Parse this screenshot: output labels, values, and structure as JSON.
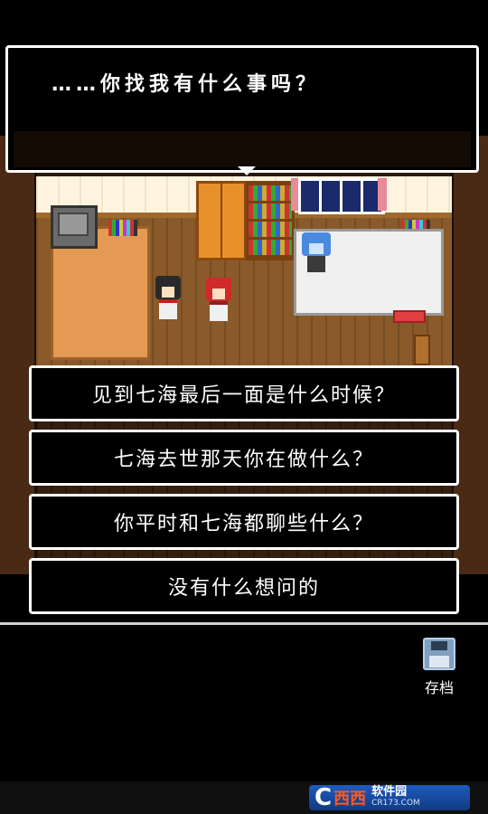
{
  "dialogue": {
    "text": "……你找我有什么事吗？"
  },
  "choices": [
    {
      "label": "见到七海最后一面是什么时候？"
    },
    {
      "label": "七海去世那天你在做什么？"
    },
    {
      "label": "你平时和七海都聊些什么？"
    },
    {
      "label": "没有什么想问的"
    }
  ],
  "toolbar": {
    "save_label": "存档",
    "save_icon": "floppy-disk-icon"
  },
  "watermark": {
    "logo_letter": "C",
    "logo_brand": "西西",
    "name": "软件园",
    "url": "CR173.COM"
  },
  "colors": {
    "background": "#000000",
    "border": "#ffffff",
    "wood": "#8a5a2a",
    "save_icon": "#7fa0c0"
  }
}
